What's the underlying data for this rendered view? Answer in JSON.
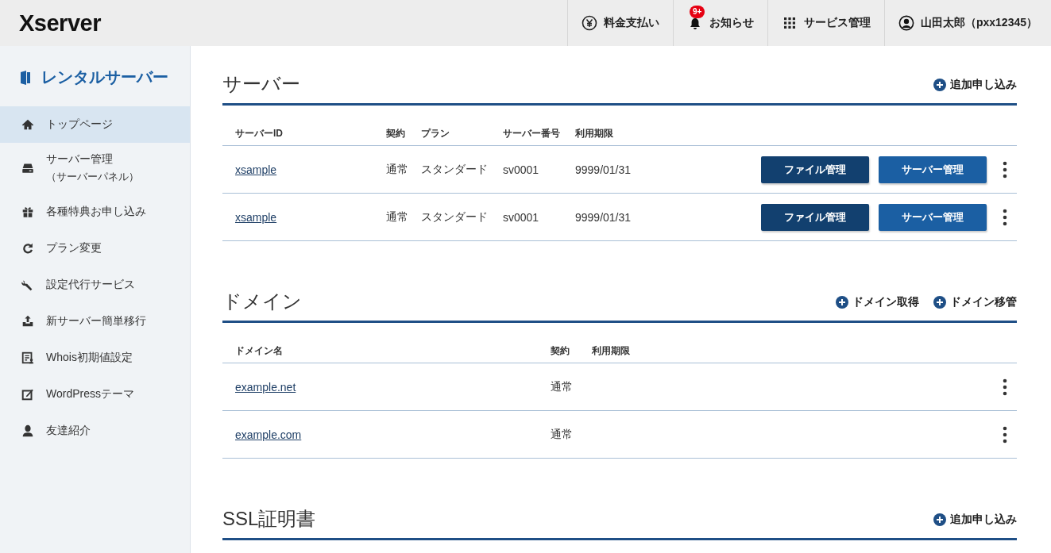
{
  "header": {
    "logo": "Xserver",
    "nav": [
      {
        "kind": "payment",
        "label": "料金支払い"
      },
      {
        "kind": "notice",
        "label": "お知らせ",
        "badge": "9+"
      },
      {
        "kind": "services",
        "label": "サービス管理"
      },
      {
        "kind": "user",
        "label": "山田太郎（pxx12345）"
      }
    ]
  },
  "sidebar": {
    "title": "レンタルサーバー",
    "items": [
      {
        "kind": "home",
        "label": "トップページ",
        "selected": true
      },
      {
        "kind": "server",
        "label": "サーバー管理",
        "sublabel": "（サーバーパネル）",
        "selected": false
      },
      {
        "kind": "gift",
        "label": "各種特典お申し込み",
        "selected": false
      },
      {
        "kind": "refresh",
        "label": "プラン変更",
        "selected": false
      },
      {
        "kind": "wrench",
        "label": "設定代行サービス",
        "selected": false
      },
      {
        "kind": "upload",
        "label": "新サーバー簡単移行",
        "selected": false
      },
      {
        "kind": "whois",
        "label": "Whois初期値設定",
        "selected": false
      },
      {
        "kind": "theme",
        "label": "WordPressテーマ",
        "selected": false
      },
      {
        "kind": "friend",
        "label": "友達紹介",
        "selected": false
      }
    ]
  },
  "sections": [
    {
      "kind": "server",
      "title": "サーバー",
      "actions": [
        "追加申し込み"
      ],
      "columns": [
        "サーバーID",
        "契約",
        "プラン",
        "サーバー番号",
        "利用期限"
      ],
      "rows": [
        {
          "cells": [
            "xsample",
            "通常",
            "スタンダード",
            "sv0001",
            "9999/01/31"
          ],
          "buttons": [
            "ファイル管理",
            "サーバー管理"
          ]
        },
        {
          "cells": [
            "xsample",
            "通常",
            "スタンダード",
            "sv0001",
            "9999/01/31"
          ],
          "buttons": [
            "ファイル管理",
            "サーバー管理"
          ]
        }
      ]
    },
    {
      "kind": "domain",
      "title": "ドメイン",
      "actions": [
        "ドメイン取得",
        "ドメイン移管"
      ],
      "columns": [
        "ドメイン名",
        "契約",
        "利用期限"
      ],
      "rows": [
        {
          "cells": [
            "example.net",
            "通常"
          ]
        },
        {
          "cells": [
            "example.com",
            "通常"
          ]
        }
      ]
    },
    {
      "title": "SSL証明書",
      "actions": [
        "追加申し込み"
      ]
    }
  ]
}
